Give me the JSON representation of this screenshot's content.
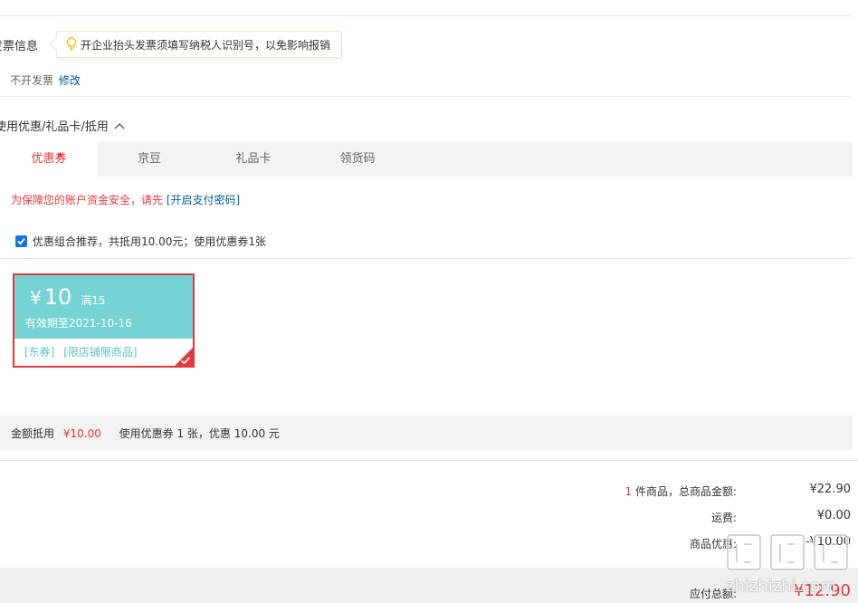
{
  "invoice": {
    "title": "发票信息",
    "tip": "开企业抬头发票须填写纳税人识别号，以免影响报销",
    "value": "不开发票",
    "edit_link": "修改"
  },
  "discount": {
    "section_title": "使用优惠/礼品卡/抵用",
    "tabs": [
      {
        "label": "优惠券"
      },
      {
        "label": "京豆"
      },
      {
        "label": "礼品卡"
      },
      {
        "label": "领货码"
      }
    ],
    "security_notice": "为保障您的账户资金安全，请先",
    "security_link": "[开启支付密码]",
    "combo_label": "优惠组合推荐，共抵用10.00元；使用优惠券1张",
    "coupon": {
      "currency": "¥",
      "amount": "10",
      "condition": "满15",
      "expiry": "有效期至2021-10-16",
      "tag1": "[东券]",
      "tag2": "[限店铺限商品]"
    },
    "summary": {
      "label": "金额抵用",
      "amount": "¥10.00",
      "detail": "使用优惠券 1 张，优惠 10.00 元"
    }
  },
  "order": {
    "count": "1",
    "count_label": "件商品，总商品金额:",
    "goods_total": "¥22.90",
    "shipping_label": "运费:",
    "shipping": "¥0.00",
    "promo_label": "商品优惠:",
    "promo": "-¥10.00",
    "payable_label": "应付总额:",
    "payable": "¥12.90"
  },
  "watermark": {
    "text": "zhizhizhi.com"
  },
  "colors": {
    "accent_red": "#e4393c",
    "link_blue": "#005ea7",
    "coupon_teal": "#75d3d4"
  }
}
